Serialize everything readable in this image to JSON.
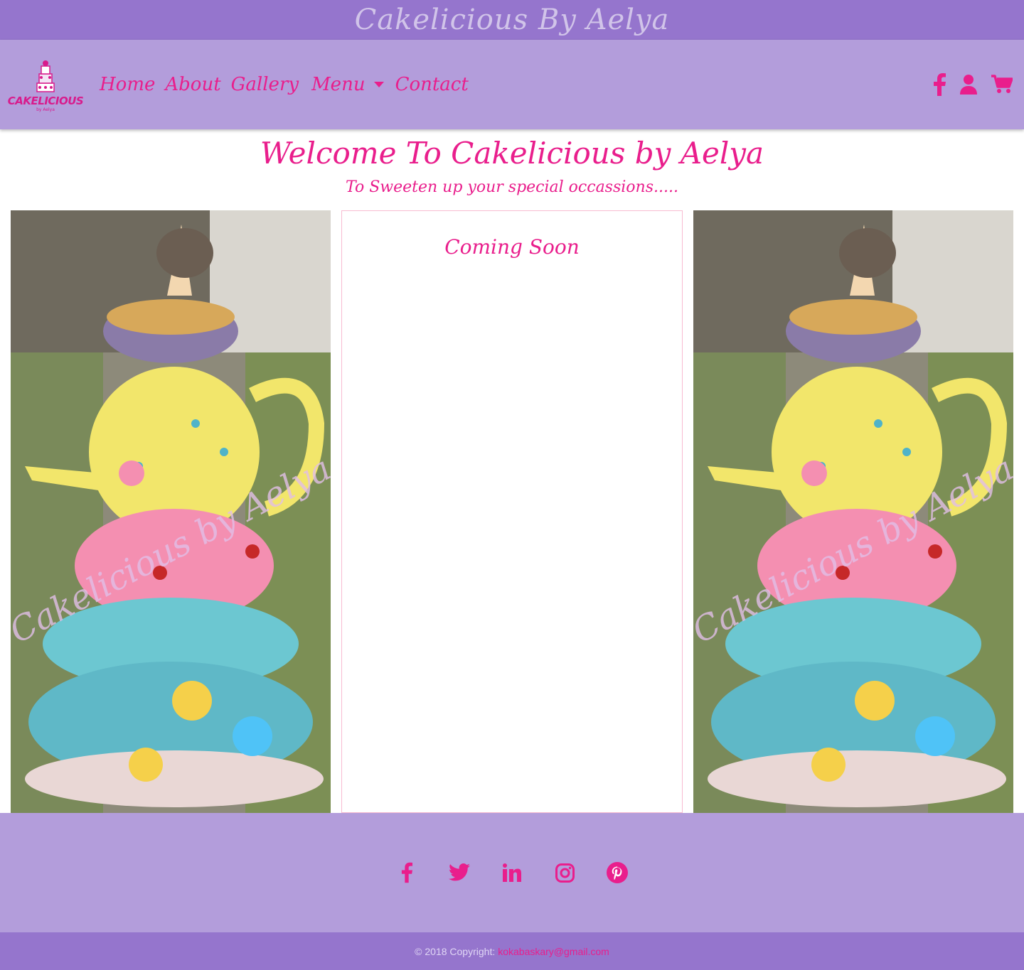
{
  "topbar": {
    "title": "Cakelicious By Aelya"
  },
  "logo": {
    "text": "CAKELICIOUS",
    "sub": "by Aelya"
  },
  "nav": {
    "links": [
      "Home",
      "About",
      "Gallery",
      "Menu",
      "Contact"
    ],
    "right_icons": [
      "facebook-icon",
      "user-icon",
      "cart-icon"
    ]
  },
  "hero": {
    "title": "Welcome To Cakelicious by Aelya",
    "subtitle": "To Sweeten up your special occassions....."
  },
  "card": {
    "heading": "Coming Soon"
  },
  "watermark": "Cakelicious by Aelya",
  "footer": {
    "social": [
      "facebook-icon",
      "twitter-icon",
      "linkedin-icon",
      "instagram-icon",
      "pinterest-icon"
    ],
    "copyright": "© 2018 Copyright:",
    "email": "kokabaskary@gmail.com"
  },
  "colors": {
    "accent": "#e91e8c",
    "nav_bg": "#b39ddb",
    "top_bg": "#9575cd"
  }
}
